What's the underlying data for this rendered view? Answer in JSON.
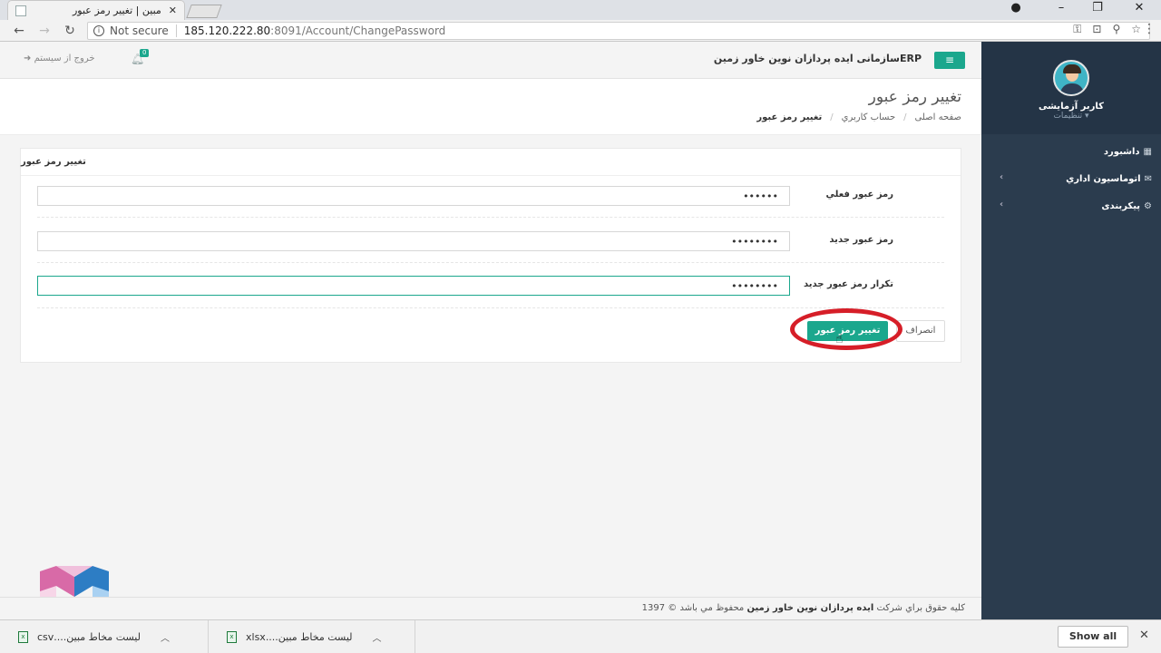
{
  "browser": {
    "tab_title": "مبین | تغییر رمز عبور",
    "tab_close": "✕",
    "security_label": "Not secure",
    "url_host": "185.120.222.80",
    "url_rest": ":8091/Account/ChangePassword"
  },
  "header": {
    "brand": "ERPسازمانی ایده پردازان نوین خاور زمین",
    "notification_count": "0",
    "logout": "خروج از سیستم"
  },
  "sidebar": {
    "user_name": "کاربر آزمایشی",
    "user_settings": "▾ تنظیمات",
    "items": [
      {
        "label": "داشبورد",
        "icon": "dashboard-icon",
        "has_submenu": false
      },
      {
        "label": "اتوماسیون اداري",
        "icon": "envelope-icon",
        "has_submenu": true
      },
      {
        "label": "پيکربندی",
        "icon": "cogs-icon",
        "has_submenu": true
      }
    ]
  },
  "page": {
    "title": "تغییر رمز عبور",
    "breadcrumb": [
      "صفحه اصلی",
      "حساب کاربري",
      "تغيير رمز عبور"
    ]
  },
  "form": {
    "panel_title": "تغيير رمز عبور",
    "fields": [
      {
        "label": "رمز عبور فعلي",
        "value": "••••••"
      },
      {
        "label": "رمز عبور جديد",
        "value": "••••••••"
      },
      {
        "label": "تکرار رمز عبور جديد",
        "value": "••••••••"
      }
    ],
    "submit_label": "تغيير رمز عبور",
    "cancel_label": "انصراف"
  },
  "footer": {
    "prefix": "کليه حقوق براي شرکت",
    "company": "ایده پردازان نوین خاور زمین",
    "suffix": "محفوظ مي باشد © 1397"
  },
  "downloads": {
    "items": [
      {
        "name": "لیست مخاط  مبین....csv",
        "type": "csv"
      },
      {
        "name": "لیست مخاط  مبین....xlsx",
        "type": "xlsx"
      }
    ],
    "show_all": "Show all"
  },
  "colors": {
    "accent": "#1ba78d",
    "sidebar": "#2b3c4e",
    "highlight": "#d61e28"
  }
}
